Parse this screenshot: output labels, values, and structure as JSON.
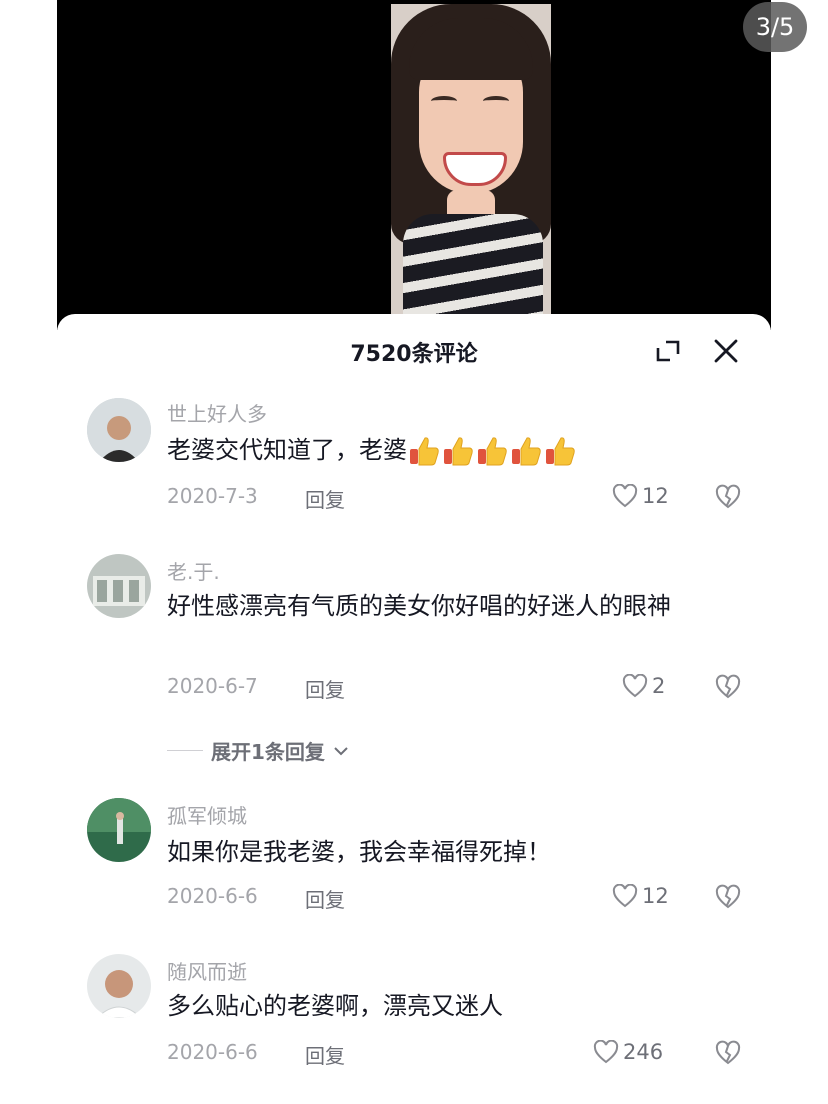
{
  "video": {
    "pager": "3/5"
  },
  "sheet": {
    "title": "7520条评论"
  },
  "comments": [
    {
      "username": "世上好人多",
      "text": "老婆交代知道了，老婆",
      "emoji": [
        "thumbs-up-icon",
        "thumbs-up-icon",
        "thumbs-up-icon",
        "thumbs-up-icon",
        "thumbs-up-icon"
      ],
      "date": "2020-7-3",
      "reply": "回复",
      "likes": "12"
    },
    {
      "username": "老.于.",
      "text": "好性感漂亮有气质的美女你好唱的好迷人的眼神",
      "date": "2020-6-7",
      "reply": "回复",
      "likes": "2",
      "more_replies": "展开1条回复"
    },
    {
      "username": "孤军倾城",
      "text": "如果你是我老婆，我会幸福得死掉！",
      "date": "2020-6-6",
      "reply": "回复",
      "likes": "12"
    },
    {
      "username": "随风而逝",
      "text": "多么贴心的老婆啊，漂亮又迷人",
      "date": "2020-6-6",
      "reply": "回复",
      "likes": "246"
    }
  ],
  "colors": {
    "primary_text": "#161823",
    "secondary_text": "#a4a5aa",
    "action_text": "#6d6f77",
    "thumb_yellow": "#f7c438"
  }
}
